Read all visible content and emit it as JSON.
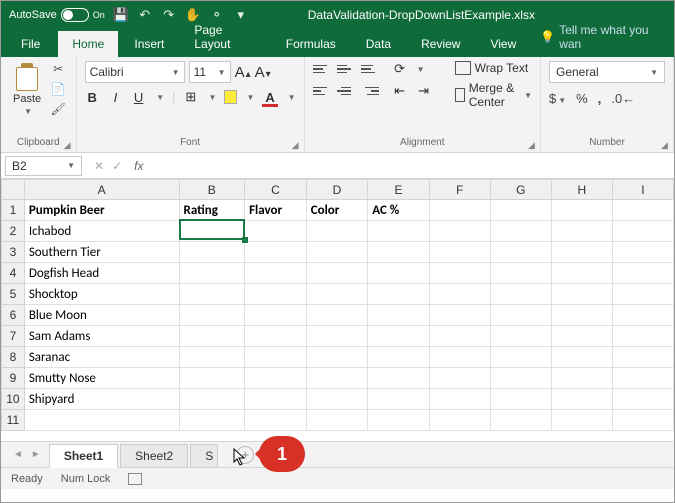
{
  "titlebar": {
    "autosave_label": "AutoSave",
    "autosave_state": "On",
    "filename": "DataValidation-DropDownListExample.xlsx"
  },
  "tabs": {
    "file": "File",
    "home": "Home",
    "insert": "Insert",
    "page_layout": "Page Layout",
    "formulas": "Formulas",
    "data": "Data",
    "review": "Review",
    "view": "View",
    "tell_me": "Tell me what you wan"
  },
  "ribbon": {
    "clipboard": {
      "paste": "Paste",
      "label": "Clipboard"
    },
    "font": {
      "name": "Calibri",
      "size": "11",
      "label": "Font"
    },
    "alignment": {
      "wrap": "Wrap Text",
      "merge": "Merge & Center",
      "label": "Alignment"
    },
    "number": {
      "format": "General",
      "label": "Number"
    }
  },
  "formula_bar": {
    "name_box": "B2",
    "fx": "fx",
    "value": ""
  },
  "columns": [
    "A",
    "B",
    "C",
    "D",
    "E",
    "F",
    "G",
    "H",
    "I"
  ],
  "rows": [
    {
      "n": "1",
      "A": "Pumpkin Beer",
      "B": "Rating",
      "C": "Flavor",
      "D": "Color",
      "E": "AC %",
      "bold": true
    },
    {
      "n": "2",
      "A": "Ichabod"
    },
    {
      "n": "3",
      "A": "Southern Tier"
    },
    {
      "n": "4",
      "A": "Dogfish Head"
    },
    {
      "n": "5",
      "A": "Shocktop"
    },
    {
      "n": "6",
      "A": "Blue Moon"
    },
    {
      "n": "7",
      "A": "Sam Adams"
    },
    {
      "n": "8",
      "A": "Saranac"
    },
    {
      "n": "9",
      "A": "Smutty Nose"
    },
    {
      "n": "10",
      "A": "Shipyard"
    },
    {
      "n": "11"
    }
  ],
  "active_cell": "B2",
  "sheet_tabs": {
    "sheet1": "Sheet1",
    "sheet2": "Sheet2",
    "partial": "S"
  },
  "callout": {
    "number": "1"
  },
  "status": {
    "ready": "Ready",
    "numlock": "Num Lock"
  }
}
